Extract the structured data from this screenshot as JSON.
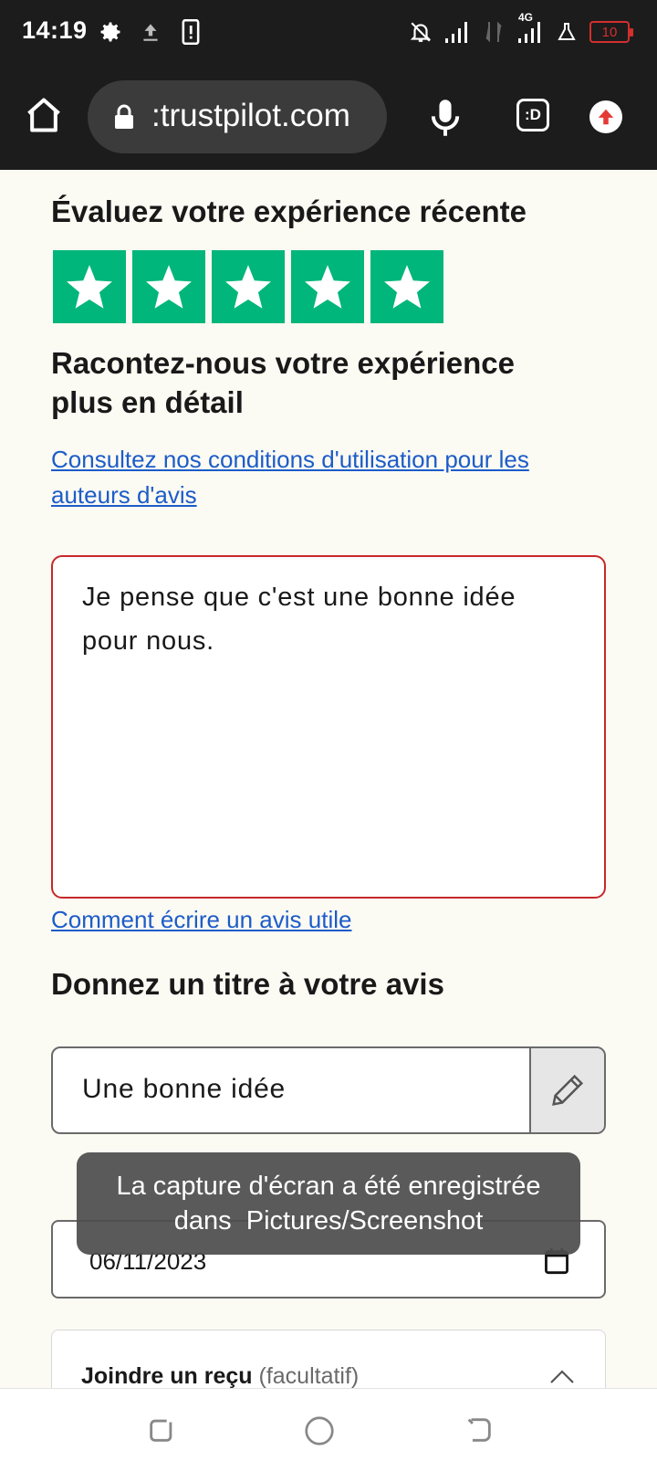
{
  "status_bar": {
    "time": "14:19",
    "left_icons": [
      "gear-icon",
      "upload-icon",
      "phone-screen-icon"
    ],
    "right_icons": [
      "bell-off-icon",
      "signal-icon",
      "data-arrows-icon",
      "4g-signal-icon",
      "flask-icon"
    ],
    "network_label": "4G",
    "battery": "10",
    "battery_color": "#d32f2f"
  },
  "browser": {
    "url": ":trustpilot.com",
    "extension_label": ":D"
  },
  "form": {
    "rate_heading": "Évaluez votre expérience récente",
    "stars": {
      "value": 5,
      "max": 5,
      "color": "#00b67a"
    },
    "detail_heading_line1": "Racontez-nous votre expérience",
    "detail_heading_line2": "plus en détail",
    "terms_link_line1": "Consultez nos conditions d'utilisation pour les",
    "terms_link_line2": "auteurs d'avis",
    "review_text": "Je pense que c'est une bonne idée pour nous.",
    "help_link": "Comment écrire un avis utile",
    "title_heading": "Donnez un titre à votre avis",
    "title_value": "Une bonne idée",
    "date_value": "06/11/2023",
    "receipt_label": "Joindre un reçu",
    "receipt_optional": "(facultatif)"
  },
  "toast": {
    "line1": "La capture d'écran a été enregistrée",
    "line2": "dans  Pictures/Screenshot"
  },
  "colors": {
    "link": "#1c5cc9",
    "error_border": "#c62828",
    "background": "#fbfaf3"
  }
}
